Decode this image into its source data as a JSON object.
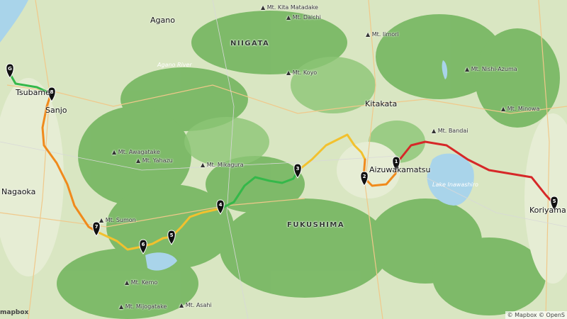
{
  "map": {
    "region_labels": [
      "NIIGATA",
      "FUKUSHIMA"
    ],
    "city_labels": [
      "Nagaoka",
      "Tsubame",
      "Sanjo",
      "Aizuwakamatsu",
      "Kitakata",
      "Koriyama",
      "Agano"
    ],
    "mountain_labels": [
      "Mt. Kita Matadake",
      "Mt. Daichi",
      "Mt. Iimori",
      "Mt. Koyo",
      "Mt. Nishi-Azuma",
      "Mt. Minowa",
      "Mt. Bandai",
      "Mt. Awagatake",
      "Mt. Yahazu",
      "Mt. Mikagura",
      "Mt. Sumon",
      "Mt. Kemo",
      "Mt. Mijogatake",
      "Mt. Asahi"
    ],
    "water_labels": [
      "Lake Inawashiro",
      "Agano River"
    ],
    "logo": "mapbox",
    "attribution": "© Mapbox © OpenS",
    "markers": [
      "1",
      "2",
      "3",
      "4",
      "5",
      "6",
      "7",
      "8",
      "9"
    ],
    "route_colors": {
      "green": "#35b84a",
      "yellow": "#f2c12e",
      "orange": "#f08a1c",
      "red": "#d62828"
    }
  }
}
